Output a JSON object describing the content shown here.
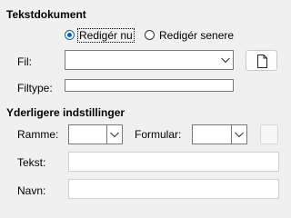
{
  "sections": {
    "document_title": "Tekstdokument",
    "more_settings_title": "Yderligere indstillinger"
  },
  "edit_mode": {
    "edit_now_label": "Redigér nu",
    "edit_later_label": "Redigér senere",
    "selected": "edit_now"
  },
  "file": {
    "label": "Fil:",
    "value": "",
    "browse_icon": "document-icon"
  },
  "filetype": {
    "label": "Filtype:",
    "value": ""
  },
  "frame": {
    "label": "Ramme:",
    "value": ""
  },
  "form": {
    "label": "Formular:",
    "value": ""
  },
  "text": {
    "label": "Tekst:",
    "value": ""
  },
  "name": {
    "label": "Navn:",
    "value": ""
  }
}
